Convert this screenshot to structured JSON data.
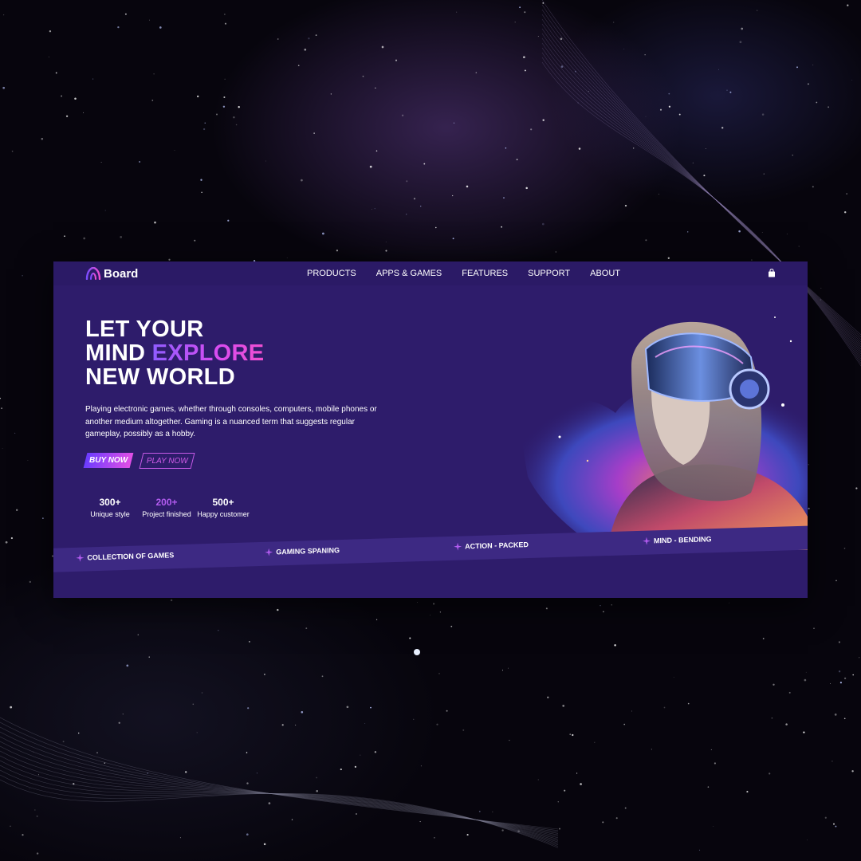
{
  "brand": {
    "name": "Board"
  },
  "nav": {
    "items": [
      {
        "label": "PRODUCTS"
      },
      {
        "label": "APPS & GAMES"
      },
      {
        "label": "FEATURES"
      },
      {
        "label": "SUPPORT"
      },
      {
        "label": "ABOUT"
      }
    ],
    "cart_icon": "shopping-bag-icon"
  },
  "hero": {
    "title_line1": "LET YOUR",
    "title_line2_plain": "MIND ",
    "title_line2_accent": "EXPLORE",
    "title_line3": "NEW WORLD",
    "description": "Playing electronic games, whether through consoles, computers, mobile phones or another medium altogether. Gaming is a nuanced term that suggests regular gameplay, possibly as a hobby.",
    "buy_label": "BUY NOW",
    "play_label": "PLAY NOW",
    "image_icon": "vr-headset-person-image"
  },
  "stats": [
    {
      "value": "300+",
      "label": "Unique style"
    },
    {
      "value": "200+",
      "label": "Project finished"
    },
    {
      "value": "500+",
      "label": "Happy customer"
    }
  ],
  "ribbon": [
    {
      "label": "COLLECTION OF GAMES"
    },
    {
      "label": "GAMING SPANING"
    },
    {
      "label": "ACTION - PACKED"
    },
    {
      "label": "MIND - BENDING"
    }
  ],
  "colors": {
    "page_background": "#07050d",
    "panel_background": "#2e1c6b",
    "accent_purple": "#8f5cff",
    "accent_pink": "#e24fe6",
    "stat_highlight": "#b35cf0"
  }
}
